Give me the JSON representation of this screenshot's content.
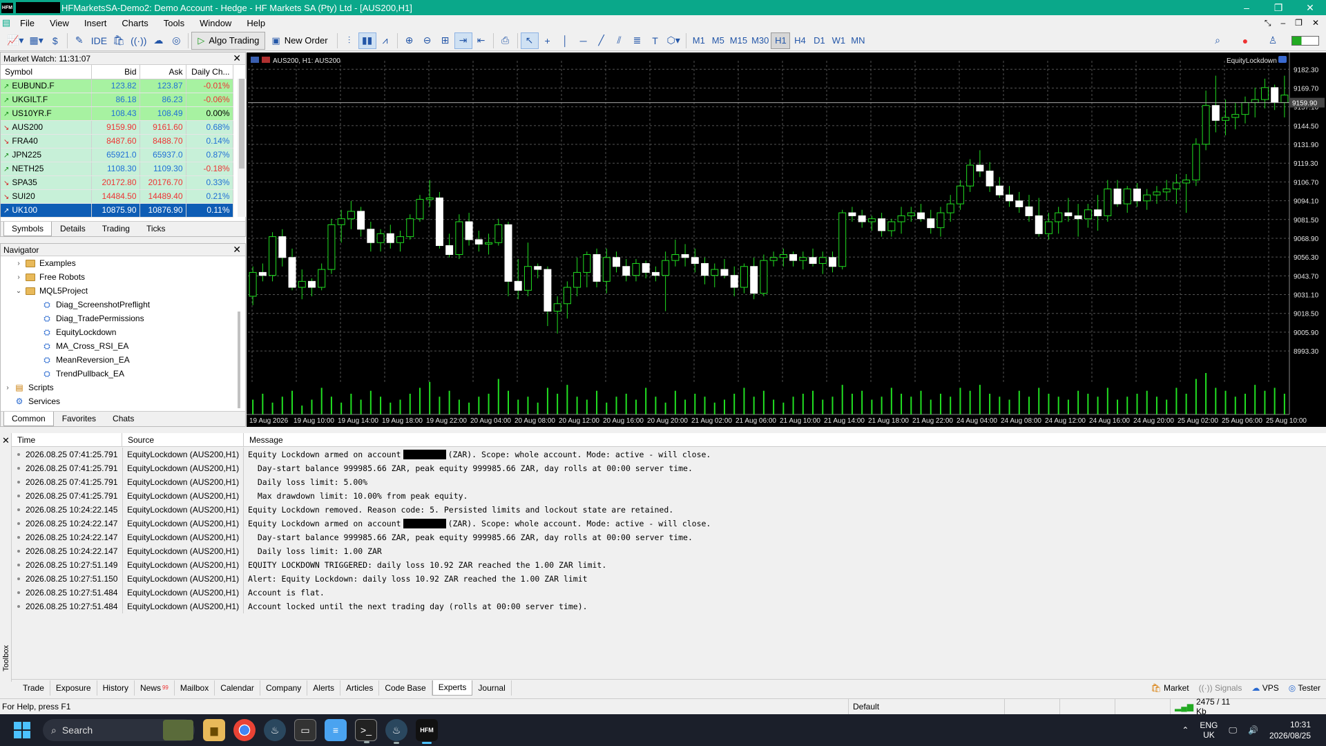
{
  "window": {
    "title": "HFMarketsSA-Demo2: Demo Account - Hedge - HF Markets SA (Pty) Ltd - [AUS200,H1]",
    "min": "–",
    "restore": "❐",
    "close": "✕"
  },
  "menu": [
    "File",
    "View",
    "Insert",
    "Charts",
    "Tools",
    "Window",
    "Help"
  ],
  "toolbar": {
    "algo_trading": "Algo Trading",
    "new_order": "New Order",
    "timeframes": [
      "M1",
      "M5",
      "M15",
      "M30",
      "H1",
      "H4",
      "D1",
      "W1",
      "MN"
    ],
    "active_tf": "H1"
  },
  "market_watch": {
    "title": "Market Watch: 11:31:07",
    "columns": [
      "Symbol",
      "Bid",
      "Ask",
      "Daily Ch..."
    ],
    "rows": [
      {
        "symbol": "EUBUND.F",
        "bid": "123.82",
        "ask": "123.87",
        "change": "-0.01%",
        "dir": "up",
        "style": "rg"
      },
      {
        "symbol": "UKGILT.F",
        "bid": "86.18",
        "ask": "86.23",
        "change": "-0.06%",
        "dir": "up",
        "style": "rg"
      },
      {
        "symbol": "US10YR.F",
        "bid": "108.43",
        "ask": "108.49",
        "change": "0.00%",
        "dir": "up",
        "style": "rg"
      },
      {
        "symbol": "AUS200",
        "bid": "9159.90",
        "ask": "9161.60",
        "change": "0.68%",
        "dir": "dn",
        "style": "rs"
      },
      {
        "symbol": "FRA40",
        "bid": "8487.60",
        "ask": "8488.70",
        "change": "0.14%",
        "dir": "dn",
        "style": "rs"
      },
      {
        "symbol": "JPN225",
        "bid": "65921.0",
        "ask": "65937.0",
        "change": "0.87%",
        "dir": "up",
        "style": "rs"
      },
      {
        "symbol": "NETH25",
        "bid": "1108.30",
        "ask": "1109.30",
        "change": "-0.18%",
        "dir": "up",
        "style": "rs"
      },
      {
        "symbol": "SPA35",
        "bid": "20172.80",
        "ask": "20176.70",
        "change": "0.33%",
        "dir": "dn",
        "style": "rs"
      },
      {
        "symbol": "SUI20",
        "bid": "14484.50",
        "ask": "14489.40",
        "change": "0.21%",
        "dir": "dn",
        "style": "rs"
      },
      {
        "symbol": "UK100",
        "bid": "10875.90",
        "ask": "10876.90",
        "change": "0.11%",
        "dir": "up",
        "style": "sel"
      }
    ],
    "tabs": [
      "Symbols",
      "Details",
      "Trading",
      "Ticks"
    ]
  },
  "navigator": {
    "title": "Navigator",
    "items": [
      {
        "label": "Examples",
        "level": 1,
        "type": "folder",
        "caret": "›"
      },
      {
        "label": "Free Robots",
        "level": 1,
        "type": "folder",
        "caret": "›"
      },
      {
        "label": "MQL5Project",
        "level": 1,
        "type": "folder",
        "caret": "⌄"
      },
      {
        "label": "Diag_ScreenshotPreflight",
        "level": 2,
        "type": "ea"
      },
      {
        "label": "Diag_TradePermissions",
        "level": 2,
        "type": "ea"
      },
      {
        "label": "EquityLockdown",
        "level": 2,
        "type": "ea"
      },
      {
        "label": "MA_Cross_RSI_EA",
        "level": 2,
        "type": "ea"
      },
      {
        "label": "MeanReversion_EA",
        "level": 2,
        "type": "ea"
      },
      {
        "label": "TrendPullback_EA",
        "level": 2,
        "type": "ea"
      },
      {
        "label": "Scripts",
        "level": 0,
        "type": "script",
        "caret": "›"
      },
      {
        "label": "Services",
        "level": 0,
        "type": "service"
      }
    ],
    "tabs": [
      "Common",
      "Favorites",
      "Chats"
    ]
  },
  "chart": {
    "symbol_label": "AUS200, H1:  AUS200",
    "ea_label": "EquityLockdown",
    "current_price": "9159.90",
    "price_labels": [
      "9182.30",
      "9169.70",
      "9157.10",
      "9144.50",
      "9131.90",
      "9119.30",
      "9106.70",
      "9094.10",
      "9081.50",
      "9068.90",
      "9056.30",
      "9043.70",
      "9031.10",
      "9018.50",
      "9005.90",
      "8993.30"
    ],
    "time_labels": [
      "19 Aug 2026",
      "19 Aug 10:00",
      "19 Aug 14:00",
      "19 Aug 18:00",
      "19 Aug 22:00",
      "20 Aug 04:00",
      "20 Aug 08:00",
      "20 Aug 12:00",
      "20 Aug 16:00",
      "20 Aug 20:00",
      "21 Aug 02:00",
      "21 Aug 06:00",
      "21 Aug 10:00",
      "21 Aug 14:00",
      "21 Aug 18:00",
      "21 Aug 22:00",
      "24 Aug 04:00",
      "24 Aug 08:00",
      "24 Aug 12:00",
      "24 Aug 16:00",
      "24 Aug 20:00",
      "25 Aug 02:00",
      "25 Aug 06:00",
      "25 Aug 10:00"
    ]
  },
  "chart_data": {
    "type": "candlestick",
    "ylim": [
      8985,
      9188
    ],
    "x": [
      1,
      2,
      3,
      4,
      5,
      6,
      7,
      8,
      9,
      10,
      11,
      12,
      13,
      14,
      15,
      16,
      17,
      18,
      19,
      20,
      21,
      22,
      23,
      24,
      25,
      26,
      27,
      28,
      29,
      30,
      31,
      32,
      33,
      34,
      35,
      36,
      37,
      38,
      39,
      40,
      41,
      42,
      43,
      44,
      45,
      46,
      47,
      48,
      49,
      50,
      51,
      52,
      53,
      54,
      55,
      56,
      57,
      58,
      59,
      60,
      61,
      62,
      63,
      64,
      65,
      66,
      67,
      68,
      69,
      70,
      71,
      72,
      73,
      74,
      75,
      76,
      77,
      78,
      79,
      80,
      81,
      82,
      83,
      84,
      85,
      86,
      87,
      88,
      89,
      90,
      91,
      92,
      93,
      94,
      95,
      96,
      97,
      98,
      99,
      100,
      101,
      102,
      103,
      104,
      105,
      106,
      107,
      108,
      109,
      110,
      111,
      112,
      113,
      114,
      115,
      116,
      117
    ],
    "candles": [
      [
        9030,
        9050,
        9024,
        9046
      ],
      [
        9046,
        9052,
        9040,
        9044
      ],
      [
        9044,
        9073,
        9040,
        9070
      ],
      [
        9070,
        9075,
        9050,
        9056
      ],
      [
        9056,
        9062,
        9034,
        9036
      ],
      [
        9036,
        9048,
        9028,
        9040
      ],
      [
        9040,
        9042,
        9030,
        9036
      ],
      [
        9036,
        9052,
        9034,
        9048
      ],
      [
        9048,
        9082,
        9045,
        9078
      ],
      [
        9078,
        9088,
        9066,
        9082
      ],
      [
        9082,
        9094,
        9075,
        9087
      ],
      [
        9087,
        9090,
        9070,
        9075
      ],
      [
        9075,
        9080,
        9060,
        9066
      ],
      [
        9066,
        9075,
        9060,
        9072
      ],
      [
        9072,
        9078,
        9062,
        9066
      ],
      [
        9066,
        9074,
        9060,
        9070
      ],
      [
        9070,
        9085,
        9068,
        9082
      ],
      [
        9082,
        9098,
        9080,
        9095
      ],
      [
        9095,
        9108,
        9090,
        9096
      ],
      [
        9096,
        9100,
        9062,
        9064
      ],
      [
        9064,
        9072,
        9056,
        9058
      ],
      [
        9058,
        9085,
        9055,
        9080
      ],
      [
        9080,
        9086,
        9064,
        9068
      ],
      [
        9068,
        9074,
        9060,
        9065
      ],
      [
        9065,
        9072,
        9058,
        9066
      ],
      [
        9066,
        9082,
        9064,
        9078
      ],
      [
        9078,
        9080,
        9030,
        9040
      ],
      [
        9040,
        9055,
        9028,
        9034
      ],
      [
        9034,
        9066,
        9030,
        9050
      ],
      [
        9050,
        9052,
        9042,
        9048
      ],
      [
        9048,
        9050,
        9010,
        9020
      ],
      [
        9020,
        9030,
        9005,
        9025
      ],
      [
        9025,
        9040,
        9015,
        9036
      ],
      [
        9036,
        9056,
        9030,
        9046
      ],
      [
        9046,
        9060,
        9036,
        9058
      ],
      [
        9058,
        9062,
        9036,
        9040
      ],
      [
        9040,
        9062,
        9032,
        9056
      ],
      [
        9056,
        9060,
        9046,
        9050
      ],
      [
        9050,
        9055,
        9040,
        9044
      ],
      [
        9044,
        9055,
        9040,
        9052
      ],
      [
        9052,
        9054,
        9042,
        9046
      ],
      [
        9046,
        9050,
        9040,
        9044
      ],
      [
        9044,
        9060,
        9020,
        9054
      ],
      [
        9054,
        9068,
        9050,
        9058
      ],
      [
        9058,
        9065,
        9050,
        9056
      ],
      [
        9056,
        9062,
        9046,
        9052
      ],
      [
        9052,
        9056,
        9038,
        9044
      ],
      [
        9044,
        9052,
        9036,
        9048
      ],
      [
        9048,
        9055,
        9042,
        9044
      ],
      [
        9044,
        9050,
        9030,
        9036
      ],
      [
        9036,
        9052,
        9032,
        9050
      ],
      [
        9050,
        9056,
        9028,
        9032
      ],
      [
        9032,
        9058,
        9030,
        9054
      ],
      [
        9054,
        9060,
        9050,
        9056
      ],
      [
        9056,
        9062,
        9050,
        9058
      ],
      [
        9058,
        9060,
        9050,
        9054
      ],
      [
        9054,
        9060,
        9048,
        9056
      ],
      [
        9056,
        9062,
        9050,
        9052
      ],
      [
        9052,
        9060,
        9045,
        9056
      ],
      [
        9056,
        9060,
        9046,
        9050
      ],
      [
        9050,
        9088,
        9048,
        9086
      ],
      [
        9086,
        9090,
        9080,
        9084
      ],
      [
        9084,
        9088,
        9076,
        9080
      ],
      [
        9080,
        9084,
        9074,
        9082
      ],
      [
        9082,
        9086,
        9070,
        9074
      ],
      [
        9074,
        9082,
        9070,
        9080
      ],
      [
        9080,
        9090,
        9072,
        9084
      ],
      [
        9084,
        9090,
        9080,
        9086
      ],
      [
        9086,
        9092,
        9080,
        9082
      ],
      [
        9082,
        9088,
        9072,
        9076
      ],
      [
        9076,
        9090,
        9070,
        9086
      ],
      [
        9086,
        9098,
        9080,
        9092
      ],
      [
        9092,
        9108,
        9088,
        9104
      ],
      [
        9104,
        9122,
        9100,
        9118
      ],
      [
        9118,
        9128,
        9110,
        9114
      ],
      [
        9114,
        9120,
        9100,
        9104
      ],
      [
        9104,
        9110,
        9096,
        9098
      ],
      [
        9098,
        9104,
        9090,
        9094
      ],
      [
        9094,
        9100,
        9086,
        9090
      ],
      [
        9090,
        9098,
        9080,
        9084
      ],
      [
        9084,
        9096,
        9070,
        9072
      ],
      [
        9072,
        9086,
        9068,
        9080
      ],
      [
        9080,
        9090,
        9072,
        9086
      ],
      [
        9086,
        9096,
        9080,
        9084
      ],
      [
        9084,
        9092,
        9070,
        9082
      ],
      [
        9082,
        9092,
        9076,
        9088
      ],
      [
        9088,
        9098,
        9074,
        9084
      ],
      [
        9084,
        9108,
        9080,
        9102
      ],
      [
        9102,
        9108,
        9090,
        9092
      ],
      [
        9092,
        9104,
        9086,
        9102
      ],
      [
        9102,
        9106,
        9090,
        9094
      ],
      [
        9094,
        9102,
        9088,
        9098
      ],
      [
        9098,
        9104,
        9092,
        9100
      ],
      [
        9100,
        9108,
        9094,
        9102
      ],
      [
        9102,
        9112,
        9092,
        9106
      ],
      [
        9106,
        9112,
        9086,
        9108
      ],
      [
        9108,
        9136,
        9104,
        9132
      ],
      [
        9132,
        9168,
        9128,
        9158
      ],
      [
        9158,
        9178,
        9140,
        9148
      ],
      [
        9148,
        9162,
        9138,
        9150
      ],
      [
        9150,
        9160,
        9142,
        9152
      ],
      [
        9152,
        9164,
        9146,
        9160
      ],
      [
        9160,
        9170,
        9150,
        9162
      ],
      [
        9162,
        9176,
        9156,
        9170
      ],
      [
        9170,
        9172,
        9155,
        9160
      ],
      [
        9160,
        9178,
        9150,
        9165
      ]
    ],
    "volume": [
      5,
      7,
      4,
      6,
      8,
      3,
      5,
      9,
      6,
      4,
      7,
      5,
      8,
      6,
      4,
      5,
      7,
      9,
      11,
      6,
      8,
      5,
      4,
      6,
      7,
      12,
      8,
      5,
      6,
      4,
      9,
      7,
      10,
      6,
      5,
      8,
      4,
      6,
      7,
      5,
      9,
      6,
      4,
      8,
      5,
      7,
      6,
      4,
      5,
      7,
      9,
      6,
      8,
      5,
      4,
      6,
      7,
      8,
      5,
      6,
      10,
      7,
      8,
      5,
      6,
      9,
      7,
      6,
      8,
      5,
      7,
      6,
      9,
      8,
      10,
      7,
      6,
      5,
      8,
      6,
      9,
      7,
      6,
      5,
      8,
      7,
      6,
      9,
      5,
      6,
      7,
      8,
      6,
      5,
      9,
      7,
      12,
      14,
      9,
      8,
      6,
      7,
      10,
      8,
      9,
      7,
      6
    ]
  },
  "journal": {
    "columns": [
      "Time",
      "Source",
      "Message"
    ],
    "rows": [
      {
        "time": "2026.08.25 07:41:25.791",
        "source": "EquityLockdown (AUS200,H1)",
        "msg_a": "Equity Lockdown armed on account",
        "msg_b": "(ZAR). Scope: whole account. Mode: active - will close.",
        "redacted": true
      },
      {
        "time": "2026.08.25 07:41:25.791",
        "source": "EquityLockdown (AUS200,H1)",
        "msg_a": "  Day-start balance 999985.66 ZAR, peak equity 999985.66 ZAR, day rolls at 00:00 server time.",
        "msg_b": "",
        "redacted": false
      },
      {
        "time": "2026.08.25 07:41:25.791",
        "source": "EquityLockdown (AUS200,H1)",
        "msg_a": "  Daily loss limit: 5.00%",
        "msg_b": "",
        "redacted": false
      },
      {
        "time": "2026.08.25 07:41:25.791",
        "source": "EquityLockdown (AUS200,H1)",
        "msg_a": "  Max drawdown limit: 10.00% from peak equity.",
        "msg_b": "",
        "redacted": false
      },
      {
        "time": "2026.08.25 10:24:22.145",
        "source": "EquityLockdown (AUS200,H1)",
        "msg_a": "Equity Lockdown removed. Reason code: 5. Persisted limits and lockout state are retained.",
        "msg_b": "",
        "redacted": false
      },
      {
        "time": "2026.08.25 10:24:22.147",
        "source": "EquityLockdown (AUS200,H1)",
        "msg_a": "Equity Lockdown armed on account",
        "msg_b": "(ZAR). Scope: whole account. Mode: active - will close.",
        "redacted": true
      },
      {
        "time": "2026.08.25 10:24:22.147",
        "source": "EquityLockdown (AUS200,H1)",
        "msg_a": "  Day-start balance 999985.66 ZAR, peak equity 999985.66 ZAR, day rolls at 00:00 server time.",
        "msg_b": "",
        "redacted": false
      },
      {
        "time": "2026.08.25 10:24:22.147",
        "source": "EquityLockdown (AUS200,H1)",
        "msg_a": "  Daily loss limit: 1.00 ZAR",
        "msg_b": "",
        "redacted": false
      },
      {
        "time": "2026.08.25 10:27:51.149",
        "source": "EquityLockdown (AUS200,H1)",
        "msg_a": "EQUITY LOCKDOWN TRIGGERED: daily loss 10.92 ZAR reached the 1.00 ZAR limit.",
        "msg_b": "",
        "redacted": false
      },
      {
        "time": "2026.08.25 10:27:51.150",
        "source": "EquityLockdown (AUS200,H1)",
        "msg_a": "Alert: Equity Lockdown: daily loss 10.92 ZAR reached the 1.00 ZAR limit",
        "msg_b": "",
        "redacted": false
      },
      {
        "time": "2026.08.25 10:27:51.484",
        "source": "EquityLockdown (AUS200,H1)",
        "msg_a": "Account is flat.",
        "msg_b": "",
        "redacted": false
      },
      {
        "time": "2026.08.25 10:27:51.484",
        "source": "EquityLockdown (AUS200,H1)",
        "msg_a": "Account locked until the next trading day (rolls at 00:00 server time).",
        "msg_b": "",
        "redacted": false
      }
    ]
  },
  "toolbox": {
    "label": "Toolbox",
    "tabs": [
      "Trade",
      "Exposure",
      "History",
      "News",
      "Mailbox",
      "Calendar",
      "Company",
      "Alerts",
      "Articles",
      "Code Base",
      "Experts",
      "Journal"
    ],
    "active": "Experts",
    "news_count": "99",
    "right": [
      "Market",
      "Signals",
      "VPS",
      "Tester"
    ]
  },
  "statusbar": {
    "help": "For Help, press F1",
    "profile": "Default",
    "traffic": "2475 / 11 Kb"
  },
  "taskbar": {
    "search": "Search",
    "lang1": "ENG",
    "lang2": "UK",
    "time": "10:31",
    "date": "2026/08/25"
  }
}
